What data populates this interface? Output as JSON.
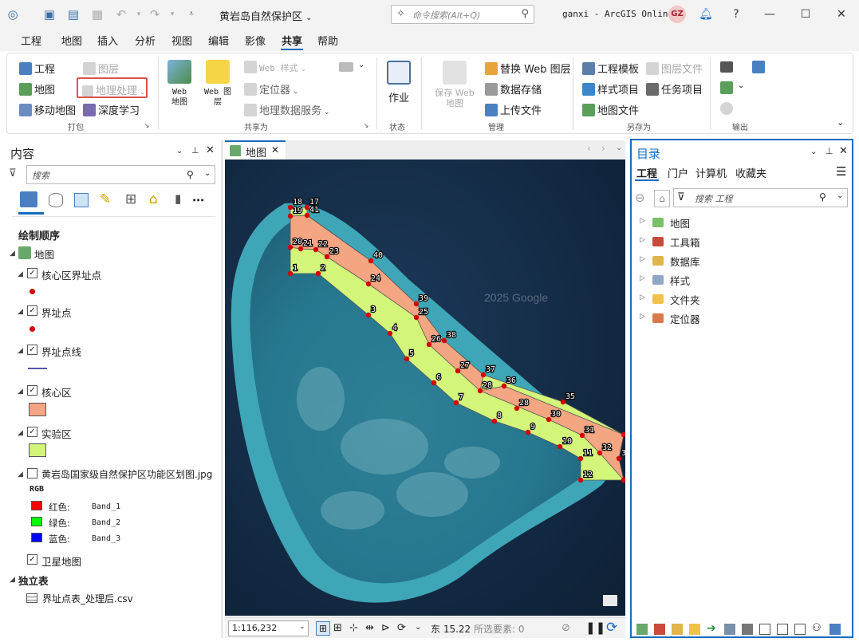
{
  "titlebar": {
    "project_title": "黄岩岛自然保护区",
    "command_search_placeholder": "命令搜索(Alt+Q)",
    "user": "ganxi - ArcGIS Online",
    "avatar_initials": "GZ"
  },
  "menu": [
    "工程",
    "地图",
    "插入",
    "分析",
    "视图",
    "编辑",
    "影像",
    "共享",
    "帮助"
  ],
  "ribbon": {
    "package": {
      "project": "工程",
      "layer": "图层",
      "map": "地图",
      "geoprocessing": "地理处理",
      "mobile_map": "移动地图",
      "deep_learning": "深度学习",
      "group": "打包"
    },
    "share_as": {
      "web_map": "Web 地图",
      "web_layer": "Web 图层",
      "web_style": "Web 样式",
      "locator": "定位器",
      "geodata_service": "地理数据服务",
      "group": "共享为"
    },
    "status": {
      "jobs": "作业",
      "group": "状态"
    },
    "manage": {
      "save_web_map": "保存 Web 地图",
      "replace_web_layer": "替换 Web 图层",
      "data_store": "数据存储",
      "upload_file": "上传文件",
      "group": "管理"
    },
    "save_as": {
      "project_template": "工程模板",
      "layer_file": "图层文件",
      "style_item": "样式项目",
      "task_item": "任务项目",
      "map_file": "地图文件",
      "group": "另存为"
    },
    "output": {
      "group": "输出"
    }
  },
  "contents": {
    "title": "内容",
    "search_placeholder": "搜索",
    "drawing_order": "绘制顺序",
    "map_node": "地图",
    "layers": [
      {
        "name": "核心区界址点",
        "checked": true
      },
      {
        "name": "界址点",
        "checked": true
      },
      {
        "name": "界址点线",
        "checked": true
      },
      {
        "name": "核心区",
        "checked": true
      },
      {
        "name": "实验区",
        "checked": true
      },
      {
        "name": "黄岩岛国家级自然保护区功能区划图.jpg",
        "checked": false
      },
      {
        "name": "卫星地图",
        "checked": true
      }
    ],
    "rgb_label": "RGB",
    "rgb_bands": [
      {
        "label": "红色:",
        "band": "Band_1",
        "color": "#ff0000"
      },
      {
        "label": "绿色:",
        "band": "Band_2",
        "color": "#00ff00"
      },
      {
        "label": "蓝色:",
        "band": "Band_3",
        "color": "#0000ff"
      }
    ],
    "standalone_tables": "独立表",
    "table_name": "界址点表_处理后.csv"
  },
  "map_view": {
    "tab": "地图",
    "scale": "1:116,232",
    "coord_label": "东 15.22",
    "selected_features": "所选要素: 0",
    "watermark": "2025 Google",
    "colors": {
      "core_zone": "#f4a582",
      "experimental_zone": "#d2f57a",
      "boundary_point": "#d40000"
    },
    "points": [
      {
        "id": "1"
      },
      {
        "id": "2"
      },
      {
        "id": "3"
      },
      {
        "id": "4"
      },
      {
        "id": "5"
      },
      {
        "id": "6"
      },
      {
        "id": "7"
      },
      {
        "id": "8"
      },
      {
        "id": "9"
      },
      {
        "id": "10"
      },
      {
        "id": "11"
      },
      {
        "id": "12"
      },
      {
        "id": "13"
      },
      {
        "id": "14"
      },
      {
        "id": "17"
      },
      {
        "id": "18"
      },
      {
        "id": "19"
      },
      {
        "id": "20"
      },
      {
        "id": "21"
      },
      {
        "id": "22"
      },
      {
        "id": "23"
      },
      {
        "id": "24"
      },
      {
        "id": "25"
      },
      {
        "id": "26"
      },
      {
        "id": "27"
      },
      {
        "id": "28"
      },
      {
        "id": "28"
      },
      {
        "id": "30"
      },
      {
        "id": "31"
      },
      {
        "id": "32"
      },
      {
        "id": "33"
      },
      {
        "id": "34"
      },
      {
        "id": "35"
      },
      {
        "id": "36"
      },
      {
        "id": "37"
      },
      {
        "id": "38"
      },
      {
        "id": "39"
      },
      {
        "id": "40"
      },
      {
        "id": "41"
      }
    ]
  },
  "catalog": {
    "title": "目录",
    "tabs": [
      "工程",
      "门户",
      "计算机",
      "收藏夹"
    ],
    "search_placeholder": "搜索 工程",
    "items": [
      "地图",
      "工具箱",
      "数据库",
      "样式",
      "文件夹",
      "定位器"
    ]
  }
}
